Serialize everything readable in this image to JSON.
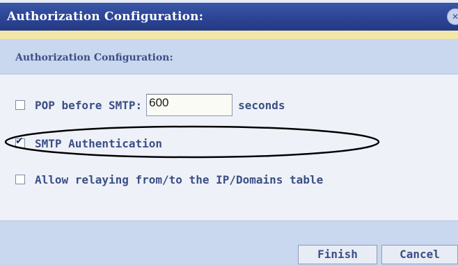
{
  "window": {
    "title": "Authorization Configuration:",
    "close_icon": "close-icon"
  },
  "section": {
    "title": "Authorization Configuration:"
  },
  "options": {
    "pop_before_smtp": {
      "label": "POP before SMTP:",
      "checked": false,
      "value": "600",
      "suffix": "seconds"
    },
    "smtp_auth": {
      "label": "SMTP Authentication",
      "checked": true
    },
    "allow_relaying": {
      "label": "Allow relaying from/to the IP/Domains table",
      "checked": false
    }
  },
  "footer": {
    "finish_label": "Finish",
    "cancel_label": "Cancel"
  },
  "colors": {
    "titlebar": "#2c4493",
    "accent_text": "#3b4f85",
    "panel": "#c9d7ef",
    "highlight_strip": "#f2e7a9"
  }
}
